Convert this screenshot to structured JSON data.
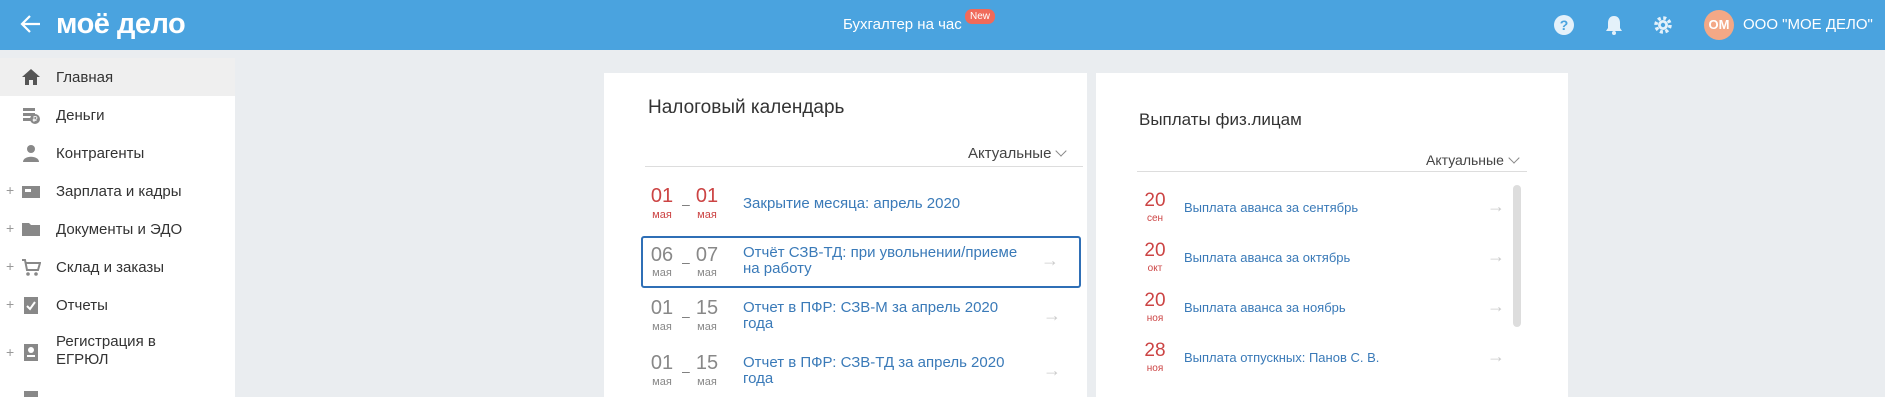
{
  "header": {
    "logo": "моё дело",
    "center_title": "Бухгалтер на час",
    "new_badge": "New",
    "avatar_initials": "ОМ",
    "org_name": "ООО \"МОЕ ДЕЛО\"",
    "icons": [
      "back-arrow-icon",
      "help-icon",
      "bell-icon",
      "gear-icon"
    ],
    "colors": {
      "bar": "#4aa3df",
      "avatar": "#f3a886",
      "badge": "#f06a5a"
    }
  },
  "sidebar": {
    "items": [
      {
        "label": "Главная",
        "icon": "home-icon",
        "expandable": false,
        "active": true
      },
      {
        "label": "Деньги",
        "icon": "money-icon",
        "expandable": false
      },
      {
        "label": "Контрагенты",
        "icon": "contractors-icon",
        "expandable": false
      },
      {
        "label": "Зарплата и кадры",
        "icon": "salary-icon",
        "expandable": true
      },
      {
        "label": "Документы и ЭДО",
        "icon": "documents-icon",
        "expandable": true
      },
      {
        "label": "Склад и заказы",
        "icon": "warehouse-icon",
        "expandable": true
      },
      {
        "label": "Отчеты",
        "icon": "reports-icon",
        "expandable": true
      },
      {
        "label": "Регистрация в ЕГРЮЛ",
        "icon": "registration-icon",
        "expandable": true
      }
    ],
    "plus_symbol": "+"
  },
  "tax_calendar": {
    "title": "Налоговый календарь",
    "filter": "Актуальные",
    "rows": [
      {
        "from_day": "01",
        "from_month": "мая",
        "to_day": "01",
        "to_month": "мая",
        "text": "Закрытие месяца: апрель 2020",
        "style": "red"
      },
      {
        "from_day": "06",
        "from_month": "мая",
        "to_day": "07",
        "to_month": "мая",
        "text": "Отчёт СЗВ-ТД: при увольнении/приеме на работу",
        "style": "grey",
        "selected": true
      },
      {
        "from_day": "01",
        "from_month": "мая",
        "to_day": "15",
        "to_month": "мая",
        "text": "Отчет в ПФР: СЗВ-М за апрель 2020 года",
        "style": "grey"
      },
      {
        "from_day": "01",
        "from_month": "мая",
        "to_day": "15",
        "to_month": "мая",
        "text": "Отчет в ПФР: СЗВ-ТД за апрель 2020 года",
        "style": "grey"
      }
    ],
    "dash": "–",
    "arrow": "→"
  },
  "payments": {
    "title": "Выплаты физ.лицам",
    "filter": "Актуальные",
    "rows": [
      {
        "day": "20",
        "month": "сен",
        "text": "Выплата аванса за сентябрь"
      },
      {
        "day": "20",
        "month": "окт",
        "text": "Выплата аванса за октябрь"
      },
      {
        "day": "20",
        "month": "ноя",
        "text": "Выплата аванса за ноябрь"
      },
      {
        "day": "28",
        "month": "ноя",
        "text": "Выплата отпускных: Панов С. В."
      }
    ],
    "arrow": "→"
  }
}
